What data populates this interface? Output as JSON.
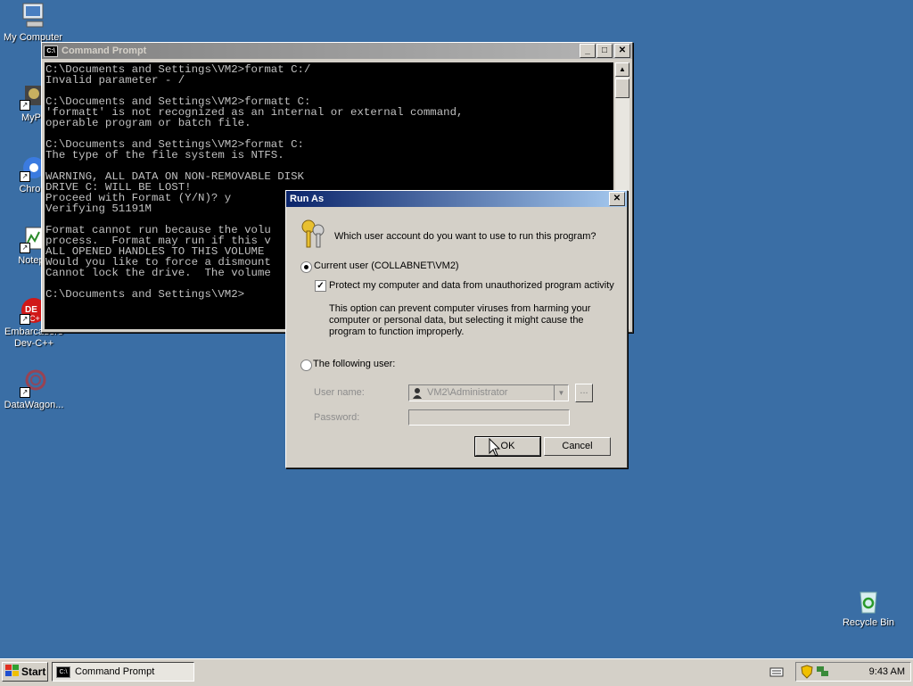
{
  "desktop": {
    "icons": [
      {
        "label": "My Computer"
      },
      {
        "label": "MyPa"
      },
      {
        "label": "Chrom"
      },
      {
        "label": "Notepa"
      },
      {
        "label": "Embarcadero Dev-C++"
      },
      {
        "label": "DataWagon..."
      },
      {
        "label": "Recycle Bin"
      }
    ]
  },
  "cmd_window": {
    "title": "Command Prompt",
    "lines": [
      "C:\\Documents and Settings\\VM2>format C:/",
      "Invalid parameter - /",
      "",
      "C:\\Documents and Settings\\VM2>formatt C:",
      "'formatt' is not recognized as an internal or external command,",
      "operable program or batch file.",
      "",
      "C:\\Documents and Settings\\VM2>format C:",
      "The type of the file system is NTFS.",
      "",
      "WARNING, ALL DATA ON NON-REMOVABLE DISK",
      "DRIVE C: WILL BE LOST!",
      "Proceed with Format (Y/N)? y",
      "Verifying 51191M",
      "",
      "Format cannot run because the volu",
      "process.  Format may run if this v",
      "ALL OPENED HANDLES TO THIS VOLUME",
      "Would you like to force a dismount",
      "Cannot lock the drive.  The volume",
      "",
      "C:\\Documents and Settings\\VM2>"
    ]
  },
  "run_as": {
    "title": "Run As",
    "question": "Which user account do you want to use to run this program?",
    "current_user_label": "Current user (COLLABNET\\VM2)",
    "protect_label": "Protect my computer and data from unauthorized program activity",
    "protect_desc": "This option can prevent computer viruses from harming your computer or personal data, but selecting it might cause the program to function improperly.",
    "following_user_label": "The following user:",
    "user_name_label": "User name:",
    "user_name_value": "VM2\\Administrator",
    "password_label": "Password:",
    "browse_label": "...",
    "ok_label": "OK",
    "cancel_label": "Cancel"
  },
  "taskbar": {
    "start_label": "Start",
    "task_label": "Command Prompt",
    "clock": "9:43 AM"
  }
}
